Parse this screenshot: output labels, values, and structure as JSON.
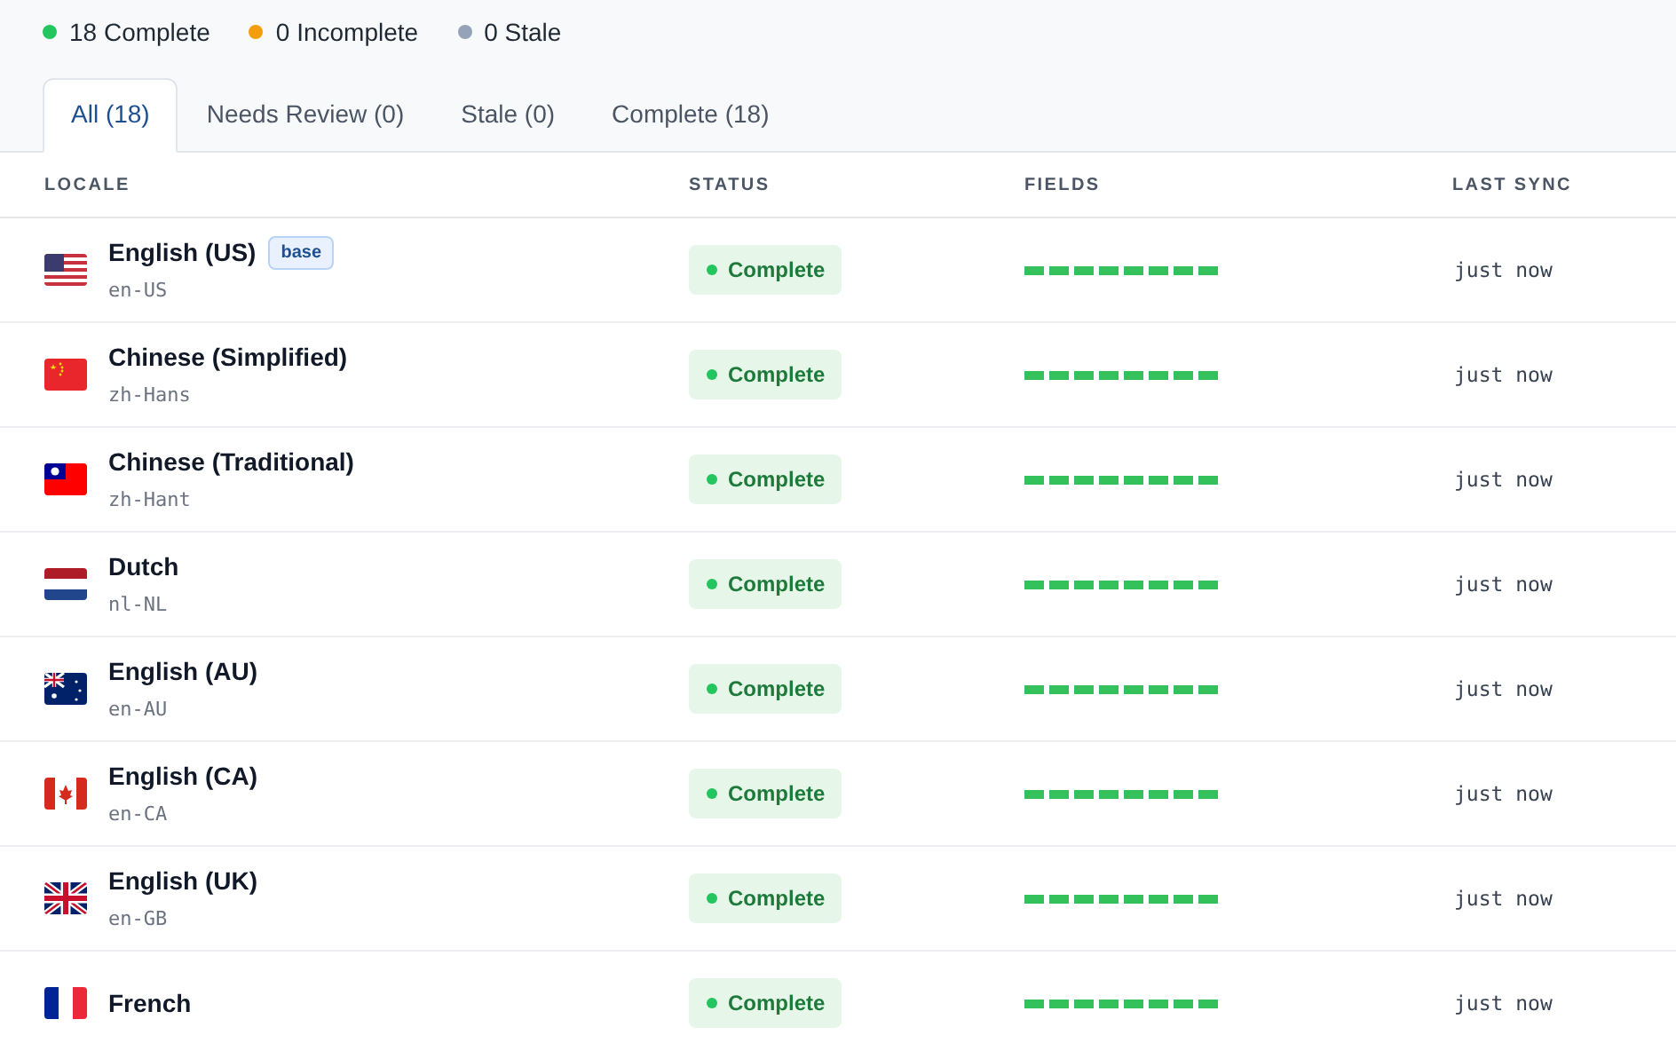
{
  "summary": [
    {
      "label": "18 Complete",
      "color": "#22c55e"
    },
    {
      "label": "0 Incomplete",
      "color": "#f59e0b"
    },
    {
      "label": "0 Stale",
      "color": "#94a3b8"
    }
  ],
  "tabs": [
    {
      "label": "All (18)",
      "selected": true
    },
    {
      "label": "Needs Review (0)",
      "selected": false
    },
    {
      "label": "Stale (0)",
      "selected": false
    },
    {
      "label": "Complete (18)",
      "selected": false
    }
  ],
  "table": {
    "columns": [
      "LOCALE",
      "STATUS",
      "FIELDS",
      "LAST SYNC"
    ],
    "rows": [
      {
        "flag": {
          "kind": "us"
        },
        "name": "English (US)",
        "badge": "base",
        "code": "en-US",
        "status": {
          "label": "Complete",
          "kind": "complete"
        },
        "fields": {
          "level": 1
        },
        "last_sync": "just now"
      },
      {
        "flag": {
          "kind": "cn"
        },
        "name": "Chinese (Simplified)",
        "code": "zh-Hans",
        "status": {
          "label": "Complete",
          "kind": "complete"
        },
        "fields": {
          "level": 1
        },
        "last_sync": "just now"
      },
      {
        "flag": {
          "kind": "tw"
        },
        "name": "Chinese (Traditional)",
        "code": "zh-Hant",
        "status": {
          "label": "Complete",
          "kind": "complete"
        },
        "fields": {
          "level": 1
        },
        "last_sync": "just now"
      },
      {
        "flag": {
          "kind": "nl"
        },
        "name": "Dutch",
        "code": "nl-NL",
        "status": {
          "label": "Complete",
          "kind": "complete"
        },
        "fields": {
          "level": 1
        },
        "last_sync": "just now"
      },
      {
        "flag": {
          "kind": "au"
        },
        "name": "English (AU)",
        "code": "en-AU",
        "status": {
          "label": "Complete",
          "kind": "complete"
        },
        "fields": {
          "level": 1
        },
        "last_sync": "just now"
      },
      {
        "flag": {
          "kind": "ca"
        },
        "name": "English (CA)",
        "code": "en-CA",
        "status": {
          "label": "Complete",
          "kind": "complete"
        },
        "fields": {
          "level": 1
        },
        "last_sync": "just now"
      },
      {
        "flag": {
          "kind": "gb"
        },
        "name": "English (UK)",
        "code": "en-GB",
        "status": {
          "label": "Complete",
          "kind": "complete"
        },
        "fields": {
          "level": 1
        },
        "last_sync": "just now"
      },
      {
        "flag": {
          "kind": "fr"
        },
        "name": "French",
        "status": {
          "label": "Complete",
          "kind": "complete"
        },
        "fields": {
          "level": 1
        },
        "last_sync": "just now"
      }
    ]
  }
}
